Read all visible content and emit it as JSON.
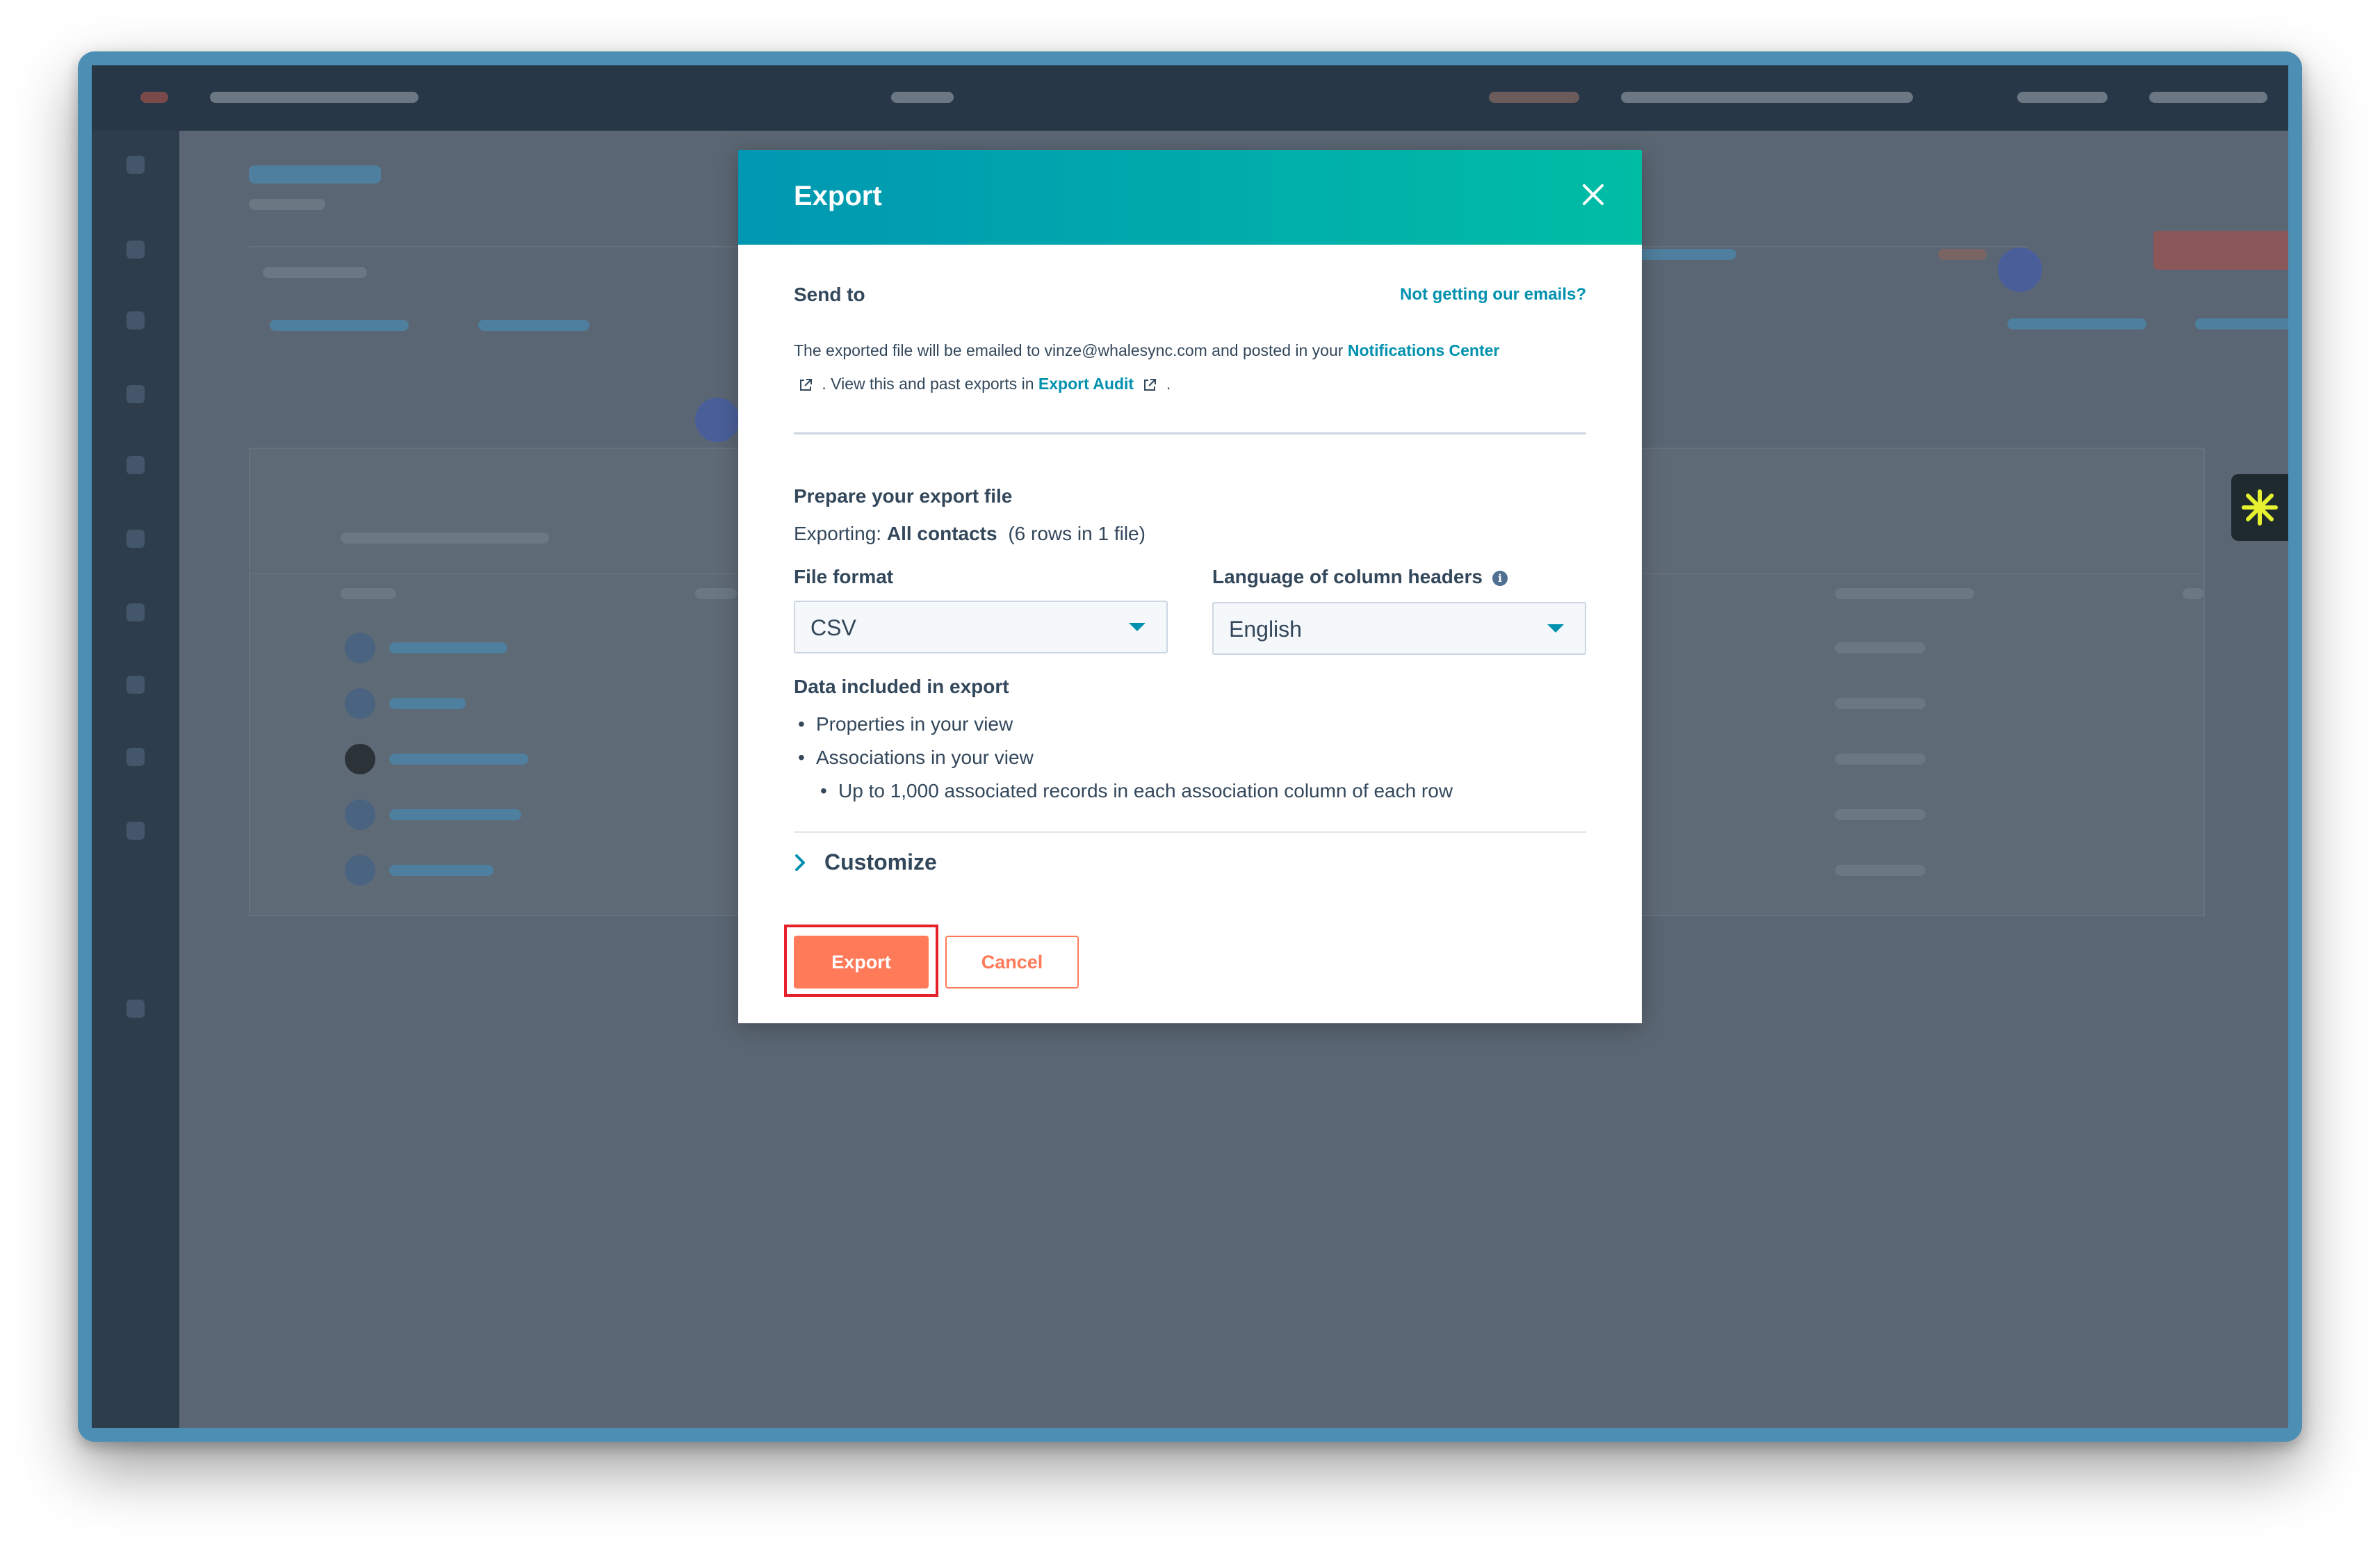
{
  "modal": {
    "title": "Export",
    "send_to_label": "Send to",
    "not_getting_emails_link": "Not getting our emails?",
    "info_text_part1": "The exported file will be emailed to vinze@whalesync.com and posted in your",
    "notifications_center_link": "Notifications Center",
    "info_text_part2": ". View this and past exports in",
    "export_audit_link": "Export Audit",
    "info_text_end": ".",
    "prepare_heading": "Prepare your export file",
    "exporting_label": "Exporting:",
    "exporting_value": "All contacts",
    "exporting_detail": "(6 rows in 1 file)",
    "file_format_label": "File format",
    "file_format_value": "CSV",
    "language_label": "Language of column headers",
    "language_value": "English",
    "data_included_heading": "Data included in export",
    "data_items": [
      "Properties in your view",
      "Associations in your view",
      "Up to 1,000 associated records in each association column of each row"
    ],
    "customize_label": "Customize",
    "export_button": "Export",
    "cancel_button": "Cancel"
  },
  "colors": {
    "header_gradient_start": "#0097b2",
    "header_gradient_end": "#00bda5",
    "primary_button": "#ff7a59",
    "link": "#0091ae",
    "highlight_box": "#e8202a",
    "overlay": "#5a6673"
  },
  "icons": {
    "close": "close-icon",
    "external_link": "external-link-icon",
    "dropdown": "caret-down-icon",
    "info": "info-icon",
    "customize_expand": "chevron-right-icon",
    "widget": "asterisk-icon"
  }
}
